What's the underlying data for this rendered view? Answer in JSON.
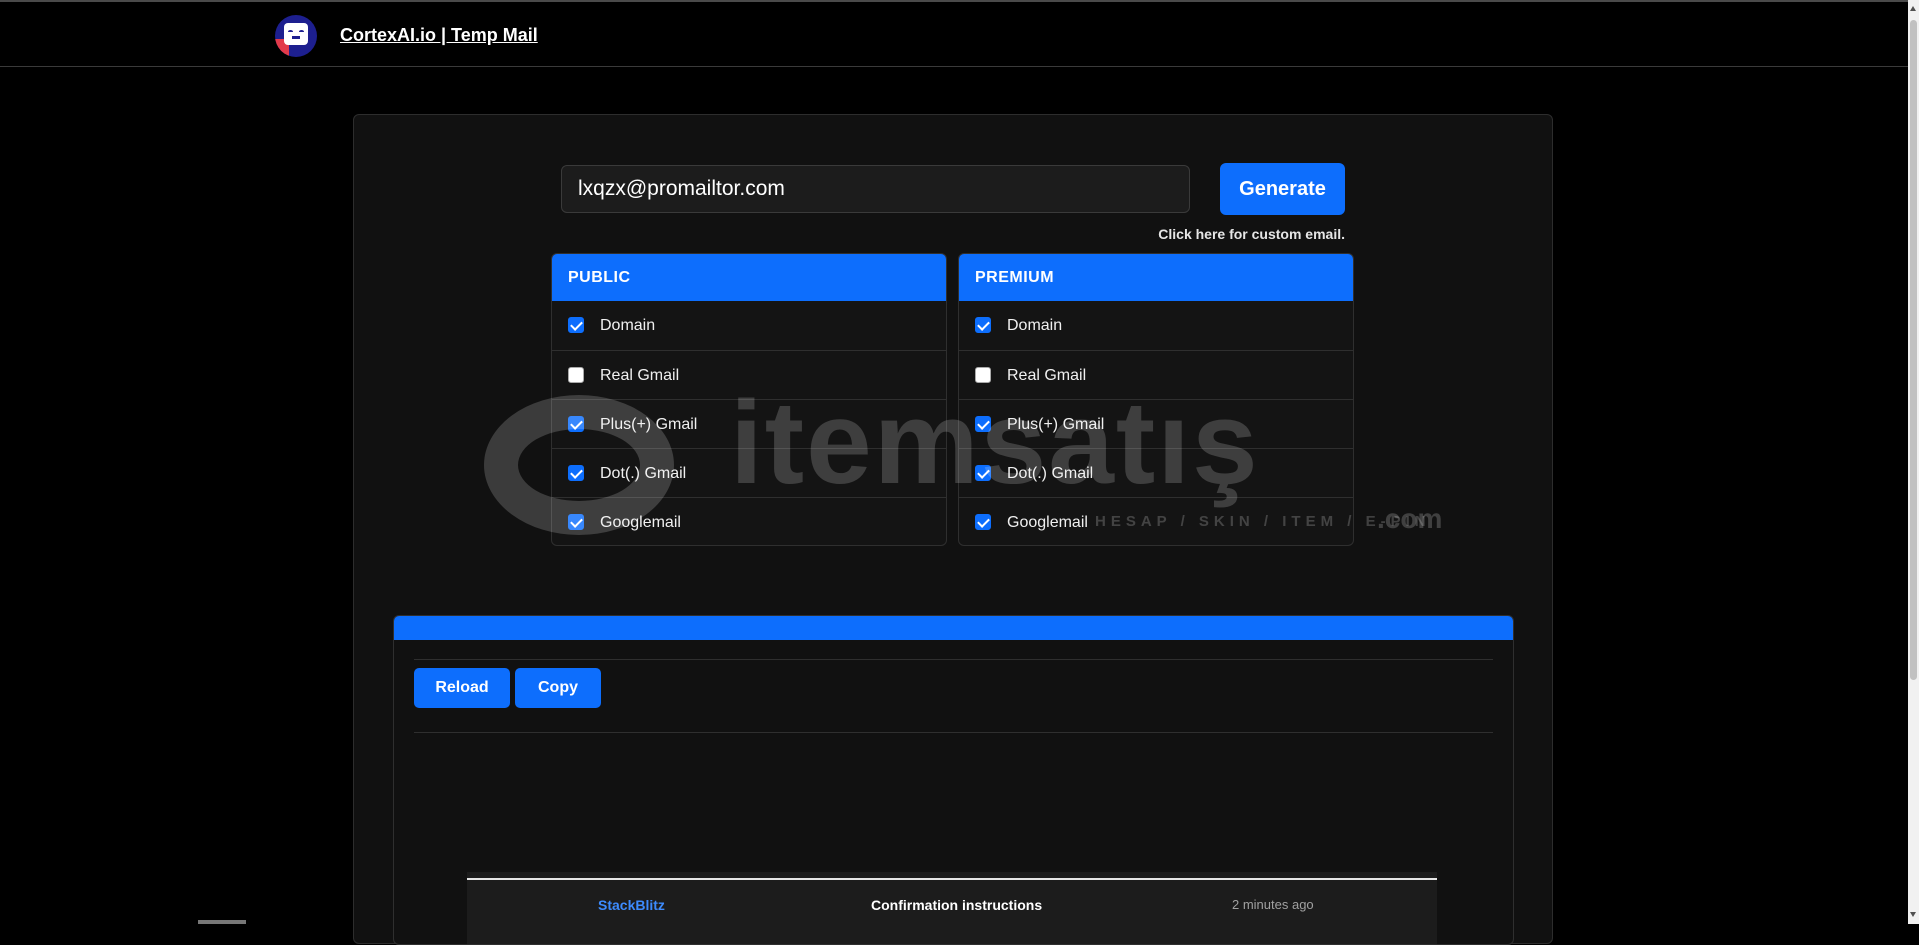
{
  "header": {
    "brand": "CortexAI.io | Temp Mail"
  },
  "generator": {
    "email_value": "lxqzx@promailtor.com",
    "generate_label": "Generate",
    "custom_link": "Click here for custom email."
  },
  "options": {
    "public": {
      "title": "PUBLIC",
      "items": [
        {
          "label": "Domain",
          "checked": true
        },
        {
          "label": "Real Gmail",
          "checked": false
        },
        {
          "label": "Plus(+) Gmail",
          "checked": true
        },
        {
          "label": "Dot(.) Gmail",
          "checked": true
        },
        {
          "label": "Googlemail",
          "checked": true
        }
      ]
    },
    "premium": {
      "title": "PREMIUM",
      "items": [
        {
          "label": "Domain",
          "checked": true
        },
        {
          "label": "Real Gmail",
          "checked": false
        },
        {
          "label": "Plus(+) Gmail",
          "checked": true
        },
        {
          "label": "Dot(.) Gmail",
          "checked": true
        },
        {
          "label": "Googlemail",
          "checked": true
        }
      ]
    }
  },
  "watermark": {
    "text": "itemsatış",
    "subtext": "HESAP / SKIN / ITEM / E-PIN",
    "suffix": ".com"
  },
  "inbox": {
    "reload_label": "Reload",
    "copy_label": "Copy",
    "messages": [
      {
        "sender": "StackBlitz",
        "subject": "Confirmation instructions",
        "time": "2 minutes ago"
      }
    ]
  },
  "colors": {
    "accent": "#0d6efd",
    "background": "#000000",
    "card": "#111111"
  }
}
